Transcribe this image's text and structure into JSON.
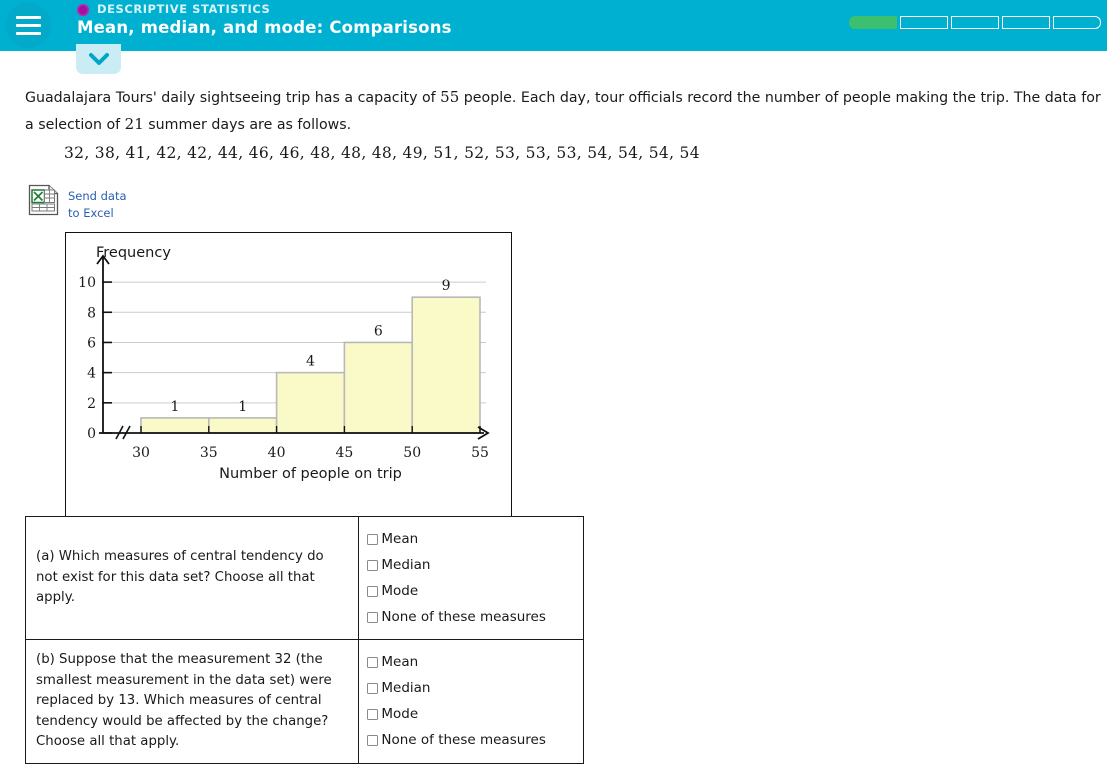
{
  "header": {
    "eyebrow": "DESCRIPTIVE STATISTICS",
    "title": "Mean, median, and mode: Comparisons",
    "menu_icon": "hamburger-icon",
    "dot_icon": "purple-dot-icon",
    "accent_color": "#00b0d0",
    "progress": {
      "total": 5,
      "completed": 1,
      "fill_color": "#3cbf6e"
    },
    "collapse_icon": "chevron-down-icon"
  },
  "problem": {
    "text_part1": "Guadalajara Tours' daily sightseeing trip has a capacity of ",
    "capacity": "55",
    "text_part2": " people. Each day, tour officials record the number of people making the trip. The data for a selection of ",
    "days": "21",
    "text_part3": " summer days are as follows.",
    "data_values": "32, 38, 41, 42, 42, 44, 46, 46, 48, 48, 48, 49, 51, 52, 53, 53, 53, 54, 54, 54, 54"
  },
  "excel": {
    "icon": "excel-file-icon",
    "line1": "Send data",
    "line2": "to Excel",
    "link_color": "#2a5fb4"
  },
  "chart_data": {
    "type": "bar",
    "title": "",
    "ylabel": "Frequency",
    "xlabel": "Number of people on trip",
    "categories": [
      "30-35",
      "35-40",
      "40-45",
      "45-50",
      "50-55"
    ],
    "bin_edges": [
      30,
      35,
      40,
      45,
      50,
      55
    ],
    "values": [
      1,
      1,
      4,
      6,
      9
    ],
    "bar_labels": [
      "1",
      "1",
      "4",
      "6",
      "9"
    ],
    "xticks": [
      "30",
      "35",
      "40",
      "45",
      "50",
      "55"
    ],
    "yticks": [
      "0",
      "2",
      "4",
      "6",
      "8",
      "10"
    ],
    "ylim": [
      0,
      11
    ],
    "xlim": [
      30,
      55
    ],
    "grid": true,
    "legend": "none",
    "axis_break": "//",
    "bar_fill": "#fafac8",
    "bar_stroke": "#b8b8b8",
    "grid_color": "#cccccc"
  },
  "questions": [
    {
      "prompt": "(a) Which measures of central tendency do not exist for this data set? Choose all that apply.",
      "options": [
        "Mean",
        "Median",
        "Mode",
        "None of these measures"
      ]
    },
    {
      "prompt": "(b) Suppose that the measurement 32 (the smallest measurement in the data set) were replaced by 13. Which measures of central tendency would be affected by the change? Choose all that apply.",
      "options": [
        "Mean",
        "Median",
        "Mode",
        "None of these measures"
      ]
    }
  ]
}
